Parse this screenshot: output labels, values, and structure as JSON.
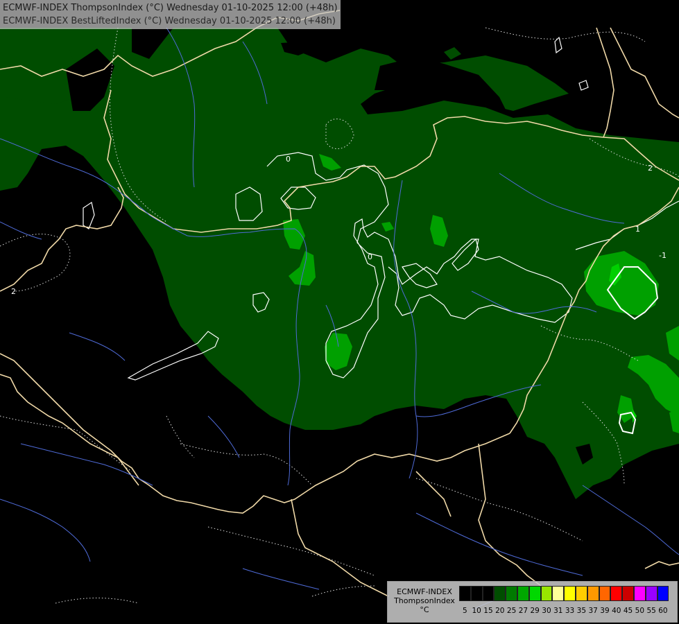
{
  "title": {
    "line1": "ECMWF-INDEX ThompsonIndex (°C) Wednesday 01-10-2025 12:00 (+48h)",
    "line2": "ECMWF-INDEX BestLiftedIndex (°C) Wednesday 01-10-2025 12:00 (+48h)"
  },
  "legend": {
    "model": "ECMWF-INDEX",
    "parameter": "ThompsonIndex",
    "unit": "°C",
    "classes": [
      {
        "value": "5",
        "color": "#000000"
      },
      {
        "value": "10",
        "color": "#000000"
      },
      {
        "value": "15",
        "color": "#000000"
      },
      {
        "value": "20",
        "color": "#004d00"
      },
      {
        "value": "25",
        "color": "#007a00"
      },
      {
        "value": "27",
        "color": "#00a800"
      },
      {
        "value": "29",
        "color": "#00d800"
      },
      {
        "value": "30",
        "color": "#99e600"
      },
      {
        "value": "31",
        "color": "#ffff99"
      },
      {
        "value": "33",
        "color": "#ffff00"
      },
      {
        "value": "35",
        "color": "#ffcc00"
      },
      {
        "value": "37",
        "color": "#ff9900"
      },
      {
        "value": "39",
        "color": "#ff6600"
      },
      {
        "value": "40",
        "color": "#ff0000"
      },
      {
        "value": "45",
        "color": "#cc0000"
      },
      {
        "value": "50",
        "color": "#ff00ff"
      },
      {
        "value": "55",
        "color": "#9900ff"
      },
      {
        "value": "60",
        "color": "#0000ff"
      }
    ]
  },
  "contour_labels": [
    "0",
    "2",
    "2",
    "0",
    "-1",
    "1"
  ],
  "colors": {
    "background": "#000000",
    "ti_20": "#004d00",
    "ti_25": "#007a00",
    "ti_27": "#00a800",
    "ti_29": "#00d800",
    "borders": "#f0d9a8",
    "rivers": "#4f6bd8",
    "contours": "#ffffff"
  }
}
